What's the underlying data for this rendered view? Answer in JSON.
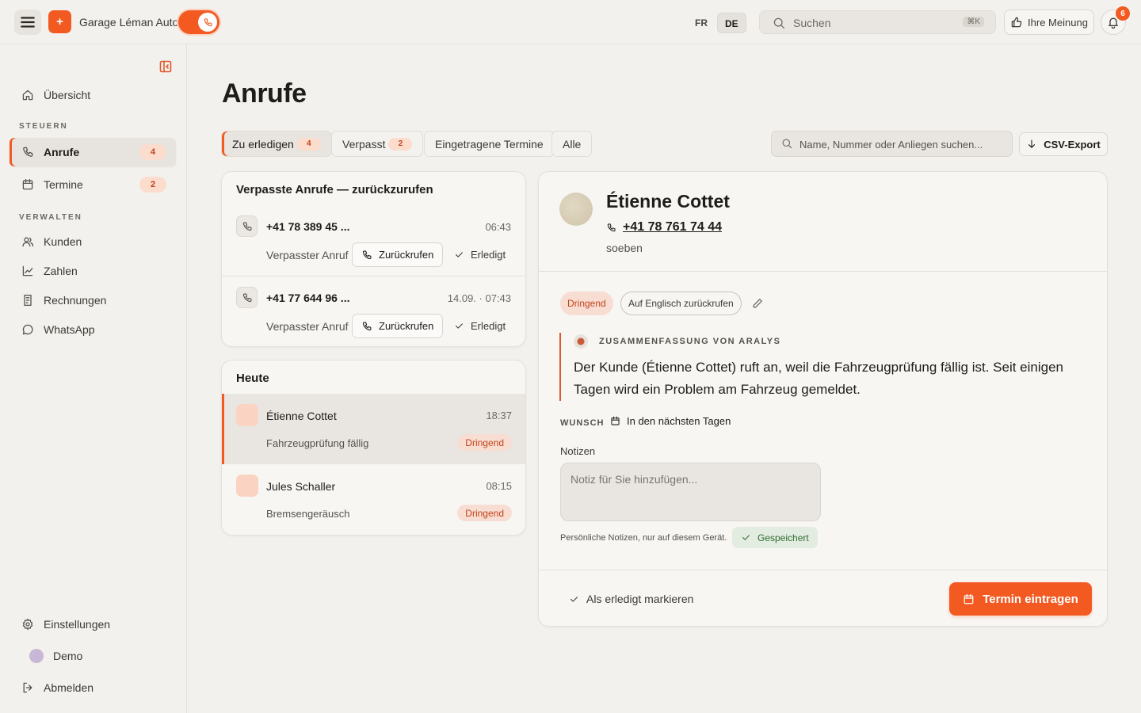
{
  "topbar": {
    "brand": "Garage Léman Auto",
    "logo_glyph": "+",
    "lang_fr": "FR",
    "lang_de": "DE",
    "search_placeholder": "Suchen",
    "search_shortcut": "⌘K",
    "feedback_label": "Ihre Meinung",
    "notification_count": "6",
    "icons": [
      "menu-icon",
      "phone-icon",
      "search-icon",
      "thumbs-up-icon",
      "bell-icon"
    ]
  },
  "sidebar": {
    "overview": "Übersicht",
    "section_steuern": "STEUERN",
    "section_verwalten": "VERWALTEN",
    "items": [
      {
        "label": "Anrufe",
        "count": "4"
      },
      {
        "label": "Termine",
        "count": "2"
      },
      {
        "label": "Kunden"
      },
      {
        "label": "Zahlen"
      },
      {
        "label": "Rechnungen"
      },
      {
        "label": "WhatsApp"
      }
    ],
    "settings": "Einstellungen",
    "demo": "Demo",
    "logout": "Abmelden"
  },
  "main": {
    "title": "Anrufe",
    "tabs": [
      {
        "label": "Zu erledigen",
        "count": "4"
      },
      {
        "label": "Verpasst",
        "count": "2"
      },
      {
        "label": "Eingetragene Termine"
      },
      {
        "label": "Alle"
      }
    ],
    "filter_placeholder": "Name, Nummer oder Anliegen suchen...",
    "csv_export": "CSV-Export"
  },
  "missed": {
    "title": "Verpasste Anrufe — zurückzurufen",
    "calls": [
      {
        "number": "+41 78 389 45 ...",
        "time": "06:43",
        "status": "Verpasster Anruf",
        "callback": "Zurückrufen",
        "done": "Erledigt"
      },
      {
        "number": "+41 77 644 96 ...",
        "time": "14.09. · 07:43",
        "status": "Verpasster Anruf",
        "callback": "Zurückrufen",
        "done": "Erledigt"
      }
    ]
  },
  "today": {
    "title": "Heute",
    "calls": [
      {
        "name": "Étienne Cottet",
        "time": "18:37",
        "reason": "Fahrzeugprüfung fällig",
        "tag": "Dringend"
      },
      {
        "name": "Jules Schaller",
        "time": "08:15",
        "reason": "Bremsengeräusch",
        "tag": "Dringend"
      }
    ]
  },
  "detail": {
    "name": "Étienne Cottet",
    "phone": "+41 78 761 74 44",
    "when": "soeben",
    "tag_urgent": "Dringend",
    "tag_language": "Auf Englisch zurückrufen",
    "summary_heading": "ZUSAMMENFASSUNG VON ARALYS",
    "summary_text": "Der Kunde (Étienne Cottet) ruft an, weil die Fahrzeugprüfung fällig ist. Seit einigen Tagen wird ein Problem am Fahrzeug gemeldet.",
    "wish_label": "WUNSCH",
    "wish_value": "In den nächsten Tagen",
    "notes_label": "Notizen",
    "notes_placeholder": "Notiz für Sie hinzufügen...",
    "notes_hint": "Persönliche Notizen, nur auf diesem Gerät.",
    "saved": "Gespeichert",
    "mark_done": "Als erledigt markieren",
    "cta": "Termin eintragen"
  },
  "colors": {
    "accent": "#f25a22",
    "urgent_bg": "#f8ddd2",
    "urgent_text": "#c2431a",
    "saved_bg": "#e3ece0"
  }
}
